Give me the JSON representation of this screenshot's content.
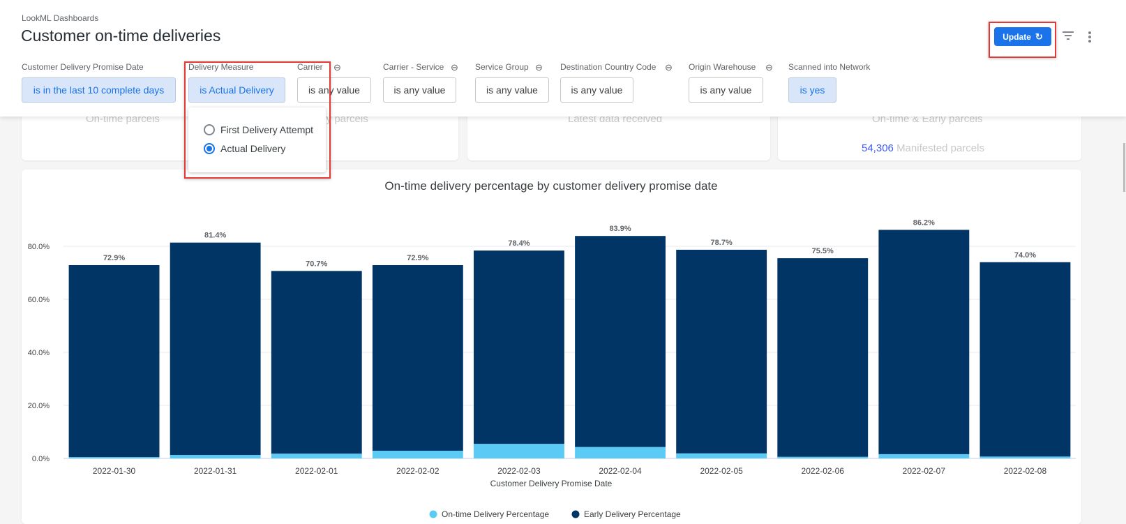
{
  "header": {
    "breadcrumb": "LookML Dashboards",
    "title": "Customer on-time deliveries",
    "update_label": "Update",
    "refresh_icon": "↻"
  },
  "filters": [
    {
      "label": "Customer Delivery Promise Date",
      "value": "is in the last 10 complete days",
      "active": true,
      "linked": false
    },
    {
      "label": "Delivery Measure",
      "value": "is Actual Delivery",
      "active": true,
      "linked": false
    },
    {
      "label": "Carrier",
      "value": "is any value",
      "active": false,
      "linked": true
    },
    {
      "label": "Carrier - Service",
      "value": "is any value",
      "active": false,
      "linked": true
    },
    {
      "label": "Service Group",
      "value": "is any value",
      "active": false,
      "linked": true
    },
    {
      "label": "Destination Country Code",
      "value": "is any value",
      "active": false,
      "linked": true
    },
    {
      "label": "Origin Warehouse",
      "value": "is any value",
      "active": false,
      "linked": true
    },
    {
      "label": "Scanned into Network",
      "value": "is yes",
      "active": true,
      "linked": false
    }
  ],
  "dropdown": {
    "options": [
      "First Delivery Attempt",
      "Actual Delivery"
    ],
    "selected": "Actual Delivery"
  },
  "tiles": {
    "ontime": "On-time parcels",
    "early": "Early parcels",
    "latest": "Latest data received",
    "ontime_early": "On-time & Early parcels",
    "manifested_count": "54,306",
    "manifested_label": "Manifested parcels"
  },
  "chart_data": {
    "type": "bar",
    "stacked": true,
    "title": "On-time delivery percentage by customer delivery promise date",
    "xlabel": "Customer Delivery Promise Date",
    "ylabel": "",
    "categories": [
      "2022-01-30",
      "2022-01-31",
      "2022-02-01",
      "2022-02-02",
      "2022-02-03",
      "2022-02-04",
      "2022-02-05",
      "2022-02-06",
      "2022-02-07",
      "2022-02-08"
    ],
    "series": [
      {
        "name": "On-time Delivery Percentage",
        "color": "#5bcbf5",
        "values": [
          0.5,
          1.3,
          1.8,
          2.9,
          5.5,
          4.3,
          1.9,
          0.6,
          1.6,
          0.7
        ]
      },
      {
        "name": "Early Delivery Percentage",
        "color": "#003566",
        "values": [
          72.4,
          80.1,
          68.9,
          70.0,
          72.9,
          79.6,
          76.8,
          74.9,
          84.6,
          73.3
        ]
      }
    ],
    "totals": [
      "72.9%",
      "81.4%",
      "70.7%",
      "72.9%",
      "78.4%",
      "83.9%",
      "78.7%",
      "75.5%",
      "86.2%",
      "74.0%"
    ],
    "yticks": [
      "0.0%",
      "20.0%",
      "40.0%",
      "60.0%",
      "80.0%"
    ],
    "ylim": [
      0,
      94
    ],
    "grid": true,
    "legend": "bottom"
  }
}
